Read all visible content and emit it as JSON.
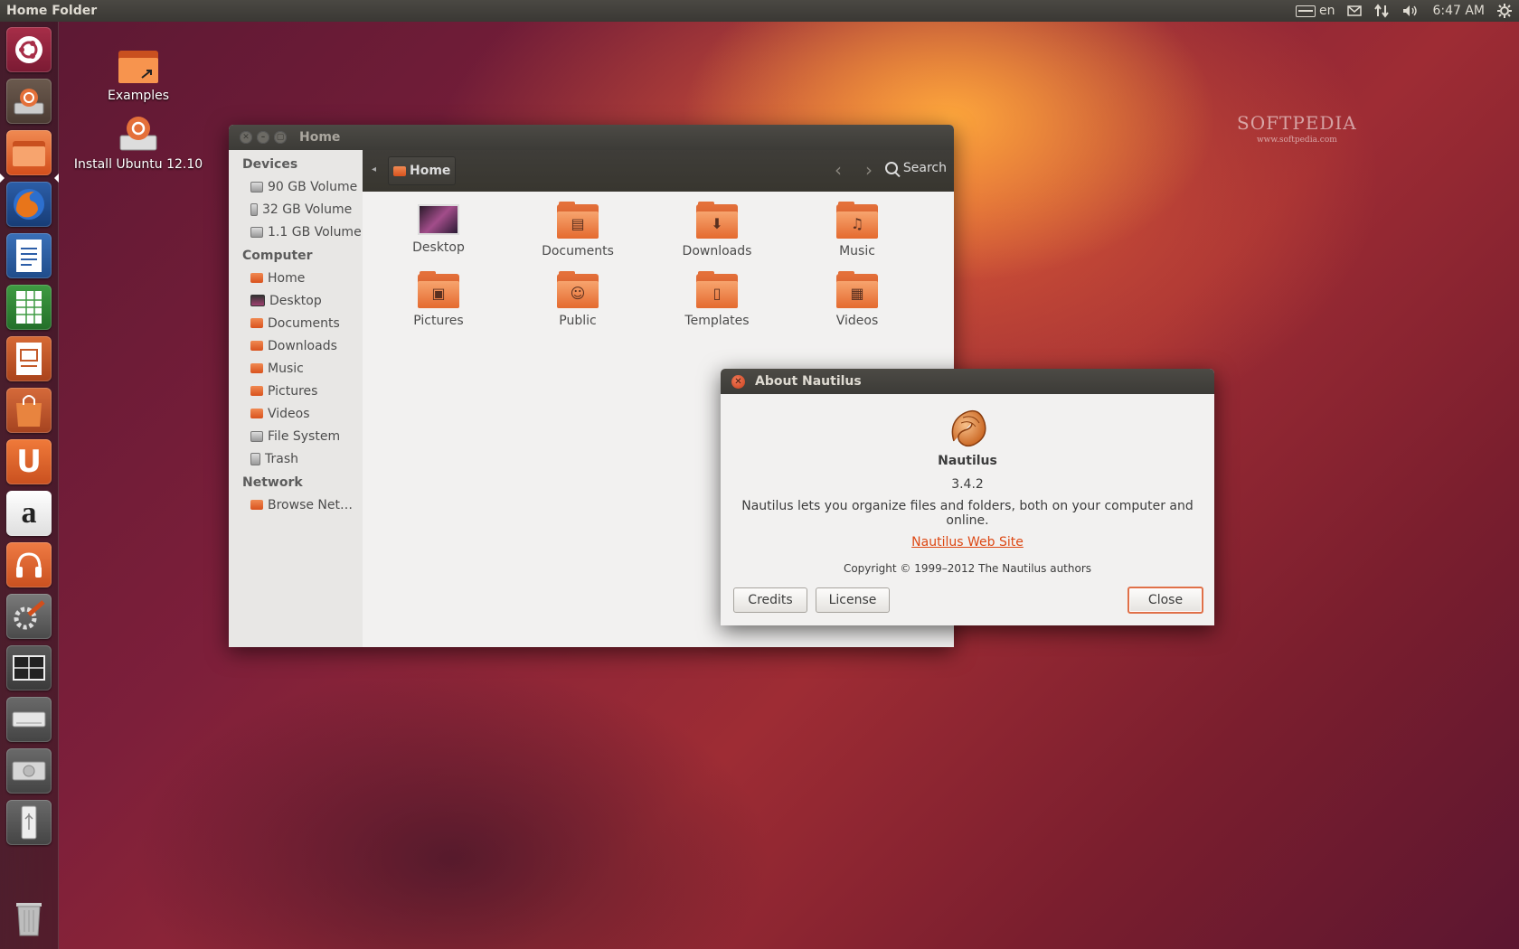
{
  "panel": {
    "title": "Home Folder",
    "keyboard_layout": "en",
    "clock": "6:47 AM"
  },
  "watermark": {
    "brand": "SOFTPEDIA",
    "url": "www.softpedia.com"
  },
  "desktop_icons": [
    {
      "label": "Examples",
      "icon": "folder-link-icon"
    },
    {
      "label": "Install Ubuntu 12.10",
      "icon": "installer-icon"
    }
  ],
  "launcher": {
    "items": [
      "dash",
      "install-ubuntu",
      "files",
      "firefox",
      "libreoffice-writer",
      "libreoffice-calc",
      "libreoffice-impress",
      "ubuntu-software-center",
      "ubuntu-one",
      "amazon",
      "ubuntu-one-music",
      "system-settings",
      "workspace-switcher",
      "removable-drive",
      "hard-drive",
      "usb-drive",
      "trash"
    ],
    "letters": {
      "ubuntu_one": "U",
      "amazon": "a"
    }
  },
  "files_window": {
    "title": "Home",
    "breadcrumb": "Home",
    "search_label": "Search",
    "sidebar": {
      "devices_header": "Devices",
      "devices": [
        "90 GB Volume",
        "32 GB Volume",
        "1.1 GB Volume"
      ],
      "computer_header": "Computer",
      "computer": [
        "Home",
        "Desktop",
        "Documents",
        "Downloads",
        "Music",
        "Pictures",
        "Videos",
        "File System",
        "Trash"
      ],
      "network_header": "Network",
      "network": [
        "Browse Net…"
      ]
    },
    "files": [
      "Desktop",
      "Documents",
      "Downloads",
      "Music",
      "Pictures",
      "Public",
      "Templates",
      "Videos"
    ]
  },
  "about_dialog": {
    "title": "About Nautilus",
    "app_name": "Nautilus",
    "version": "3.4.2",
    "description": "Nautilus lets you organize files and folders, both on your computer and online.",
    "website_label": "Nautilus Web Site",
    "copyright": "Copyright © 1999–2012 The Nautilus authors",
    "credits_button": "Credits",
    "license_button": "License",
    "close_button": "Close"
  },
  "colors": {
    "accent": "#dd4814",
    "panel": "#3c3b37",
    "window_bg": "#f2f1f0"
  }
}
